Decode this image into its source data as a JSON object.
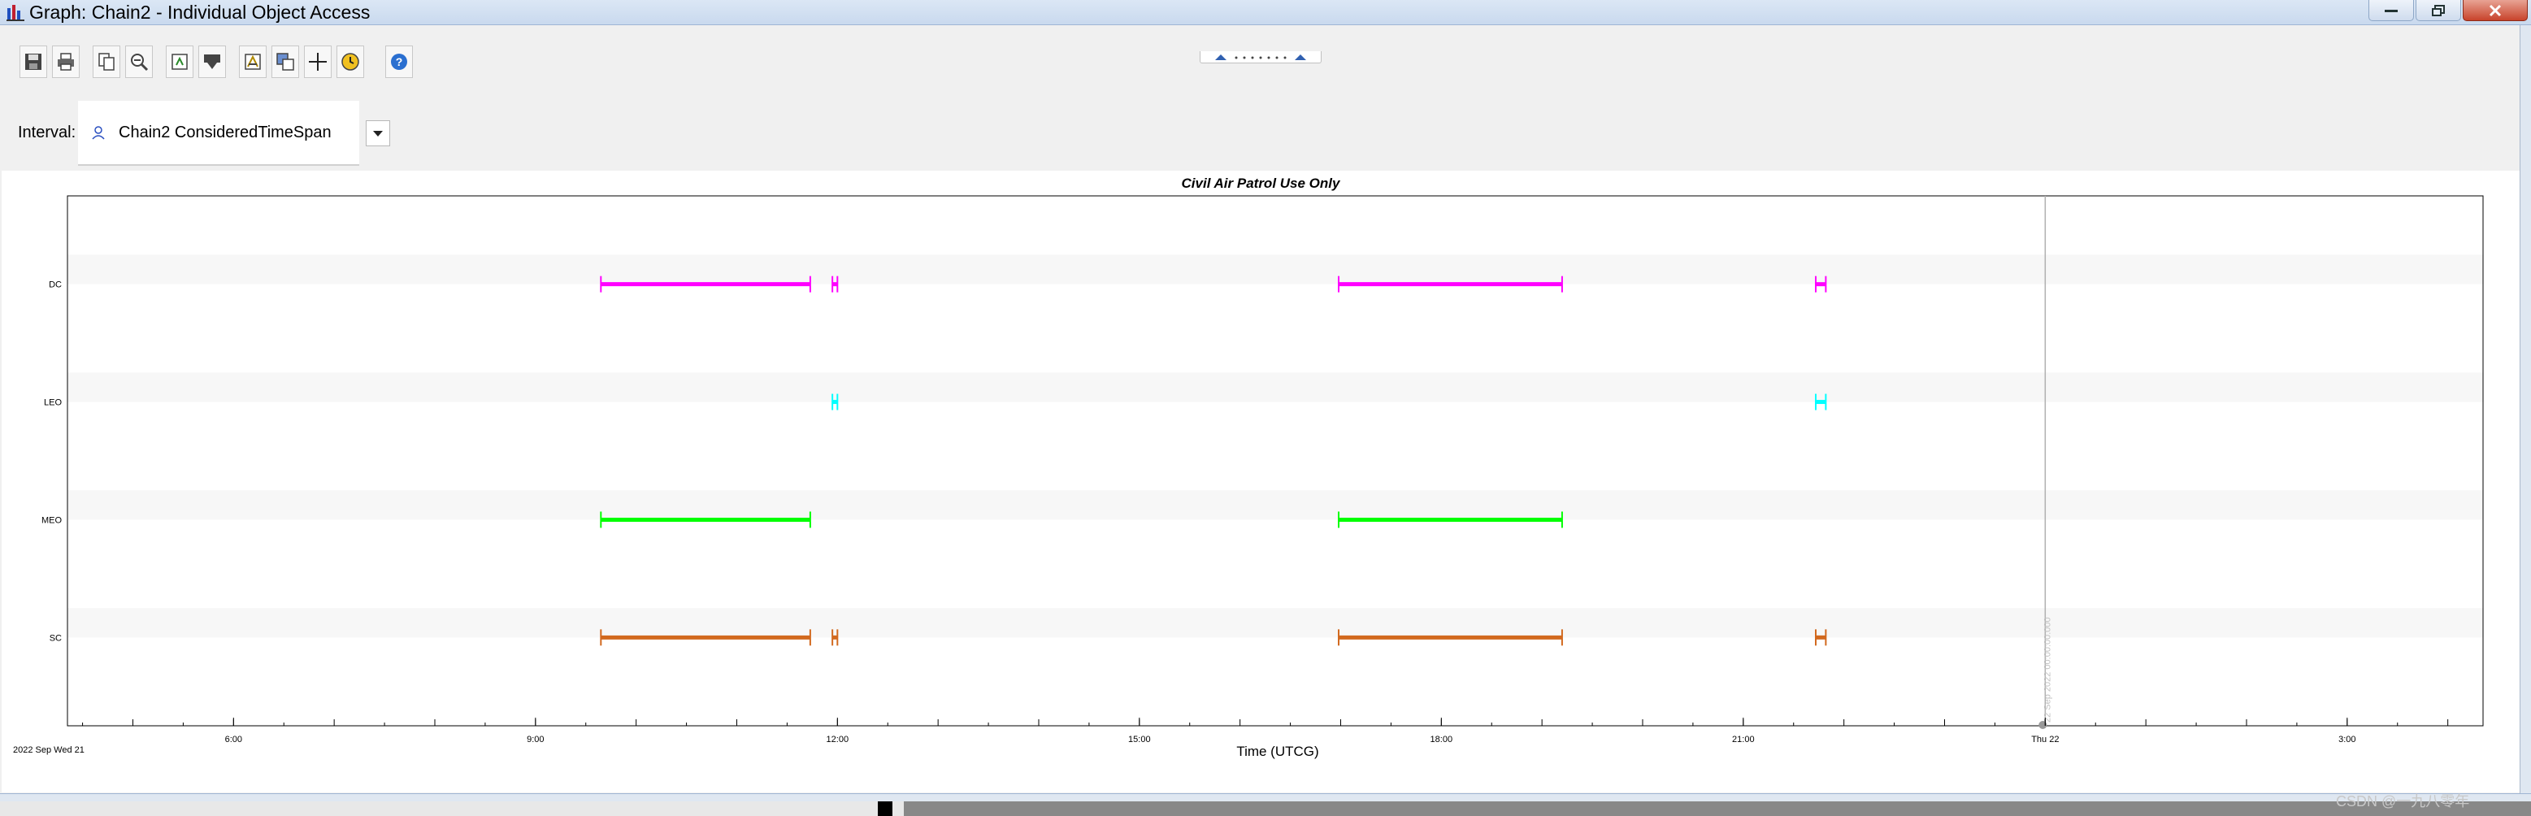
{
  "window": {
    "title": "Graph:  Chain2 - Individual Object Access"
  },
  "toolbar": {
    "buttons": [
      {
        "icon": "save-icon"
      },
      {
        "icon": "print-icon"
      },
      {
        "icon": "copy-icon"
      },
      {
        "icon": "zoom-out-icon"
      },
      {
        "icon": "export-icon"
      },
      {
        "icon": "dropdown-menu-icon"
      },
      {
        "icon": "properties-icon"
      },
      {
        "icon": "copy-graph-icon"
      },
      {
        "icon": "crosshair-icon"
      },
      {
        "icon": "time-icon"
      },
      {
        "icon": "help-icon"
      }
    ],
    "interval_label": "Interval:",
    "interval_value": "Chain2 ConsideredTimeSpan"
  },
  "graph": {
    "caption": "Civil Air Patrol Use Only",
    "start_date_label": "2022 Sep Wed 21",
    "x_axis_label": "Time (UTCG)",
    "cursor_label": "22 Sep 2022 00:00:00.000"
  },
  "chart_data": {
    "type": "timeline",
    "xlabel": "Time (UTCG)",
    "x_range_hours": [
      4.35,
      28.35
    ],
    "x_ticks": [
      {
        "hour": 6,
        "label": "6:00"
      },
      {
        "hour": 9,
        "label": "9:00"
      },
      {
        "hour": 12,
        "label": "12:00"
      },
      {
        "hour": 15,
        "label": "15:00"
      },
      {
        "hour": 18,
        "label": "18:00"
      },
      {
        "hour": 21,
        "label": "21:00"
      },
      {
        "hour": 24,
        "label": "Thu 22"
      },
      {
        "hour": 27,
        "label": "3:00"
      }
    ],
    "cursor_hour": 24,
    "series": [
      {
        "name": "DC",
        "color": "#ff00ff",
        "intervals": [
          [
            9.65,
            11.73
          ],
          [
            11.95,
            12.0
          ],
          [
            16.98,
            19.2
          ],
          [
            21.72,
            21.82
          ]
        ]
      },
      {
        "name": "LEO",
        "color": "#00ffff",
        "intervals": [
          [
            11.95,
            12.0
          ],
          [
            21.72,
            21.82
          ]
        ]
      },
      {
        "name": "MEO",
        "color": "#00ff00",
        "intervals": [
          [
            9.65,
            11.73
          ],
          [
            16.98,
            19.2
          ]
        ]
      },
      {
        "name": "SC",
        "color": "#d2691e",
        "intervals": [
          [
            9.65,
            11.73
          ],
          [
            11.95,
            12.0
          ],
          [
            16.98,
            19.2
          ],
          [
            21.72,
            21.82
          ]
        ]
      }
    ]
  },
  "watermark": "CSDN @一九八零年"
}
